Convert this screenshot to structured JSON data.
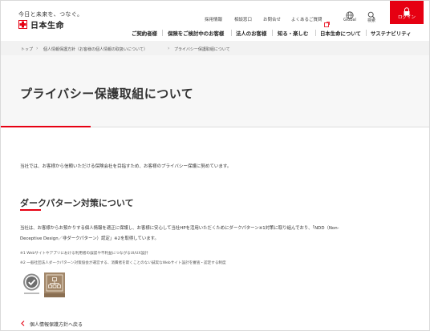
{
  "header": {
    "tagline": "今日と未来を、つなぐ。",
    "logo_text": "日本生命",
    "utility_links": [
      "採用情報",
      "相談窓口",
      "お問合せ",
      "よくあるご質問"
    ],
    "global_label": "Global",
    "search_label": "検索",
    "login_label": "ログイン"
  },
  "mainnav": {
    "items": [
      "ご契約者様",
      "保険をご検討中のお客様",
      "法人のお客様",
      "知る・楽しむ",
      "日本生命について",
      "サステナビリティ"
    ]
  },
  "breadcrumb": {
    "items": [
      "トップ",
      "個人情報保護方針（お客様の個人情報の取扱いについて）",
      "プライバシー保護取組について"
    ]
  },
  "page": {
    "title": "プライバシー保護取組について",
    "intro": "当社では、お客様から信頼いただける保険会社を目指すため、お客様のプライバシー保護に努めています。"
  },
  "section": {
    "title": "ダークパターン対策について",
    "body_line1": "当社は、お客様からお預かりする個人情報を適正に保護し、お客様に安心して当社HPを活用いただくためにダークパターン※1対策に取り組んでおり、「NDD（Non-",
    "body_line2": "Deceptive Design／非ダークパターン）認定」※2を取得しています。",
    "note1": "※1 Webサイトやアプリにおける利用者の誤認や不利益につながるUI/UX設計",
    "note2": "※2 一般社団法人ダークパターン対策協会が運営する、消費者を欺くことのない誠実なWebサイト設計を審査・認定する制度"
  },
  "footer_link": {
    "label": "個人情報保護方針へ戻る"
  },
  "colors": {
    "brand_red": "#e60012",
    "title_band": "#f7f7f7",
    "breadcrumb_bg": "#f2f2f2",
    "badge_brown": "#a2876a"
  }
}
